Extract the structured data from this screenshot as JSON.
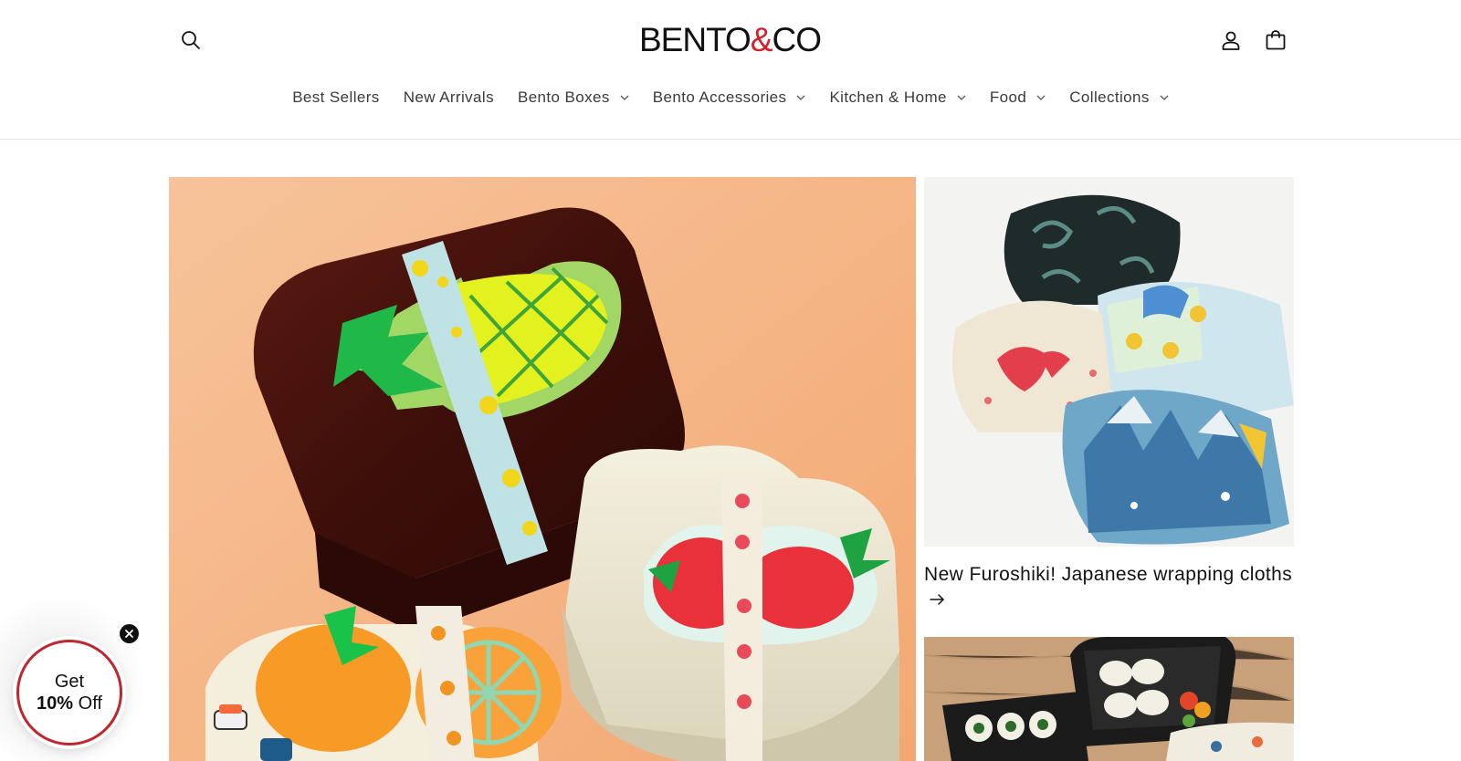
{
  "brand": {
    "logo_left": "BENTO",
    "logo_amp": "&",
    "logo_right": "CO",
    "accent_color": "#d4202a"
  },
  "header": {
    "icons": [
      "search-icon",
      "account-icon",
      "cart-icon"
    ]
  },
  "nav": {
    "items": [
      {
        "label": "Best Sellers",
        "has_dropdown": false
      },
      {
        "label": "New Arrivals",
        "has_dropdown": false
      },
      {
        "label": "Bento Boxes",
        "has_dropdown": true
      },
      {
        "label": "Bento Accessories",
        "has_dropdown": true
      },
      {
        "label": "Kitchen & Home",
        "has_dropdown": true
      },
      {
        "label": "Food",
        "has_dropdown": true
      },
      {
        "label": "Collections",
        "has_dropdown": true
      }
    ]
  },
  "hero": {
    "main_image": "bento-boxes-with-fruit-ice-packs",
    "side_card": {
      "image": "furoshiki-wrapped-boxes",
      "caption": "New Furoshiki! Japanese wrapping cloths",
      "arrow_icon": "arrow-right-icon"
    },
    "side_card_2": {
      "image": "bento-box-with-sushi"
    }
  },
  "promo": {
    "line1": "Get",
    "line2_bold": "10%",
    "line2_rest": " Off",
    "close_icon": "close-icon",
    "border_color": "#c0262e"
  }
}
